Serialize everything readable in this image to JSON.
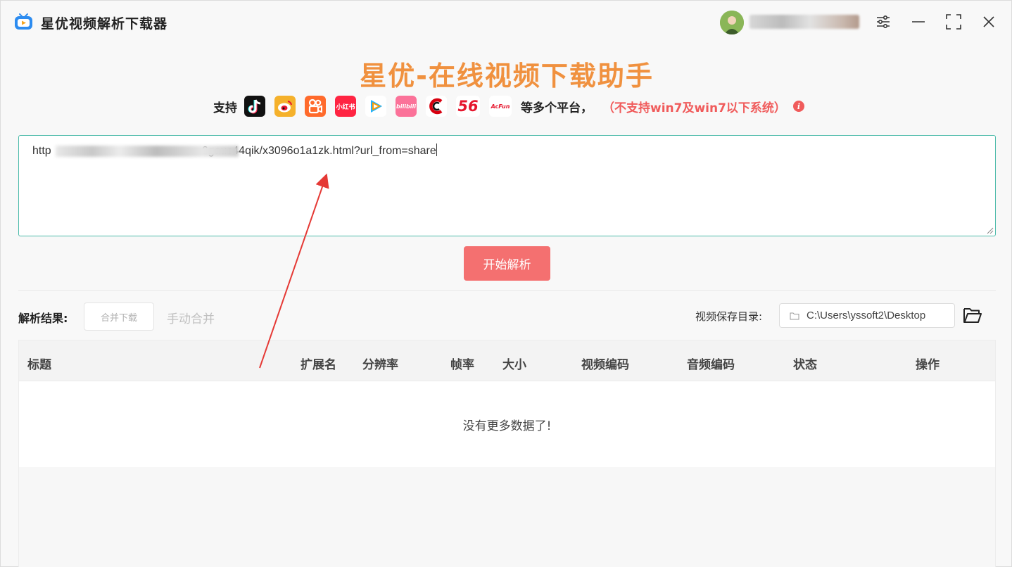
{
  "app": {
    "title": "星优视频解析下载器",
    "brand_color": "#2d8cf0"
  },
  "header": {
    "headline": "星优-在线视频下载助手",
    "support_label": "支持",
    "platforms": [
      {
        "name": "douyin-icon",
        "label": "",
        "color": "#111111"
      },
      {
        "name": "weibo-icon",
        "label": "",
        "color": "#f5b12b"
      },
      {
        "name": "kuaishou-icon",
        "label": "",
        "color": "#ff6a2b"
      },
      {
        "name": "xiaohongshu-icon",
        "label": "小红书",
        "color": "#ff2442"
      },
      {
        "name": "tencent-video-icon",
        "label": "",
        "color": "#ffffff"
      },
      {
        "name": "bilibili-icon",
        "label": "bilibili",
        "color": "#fb7299"
      },
      {
        "name": "cctv-icon",
        "label": "",
        "color": "#ffffff"
      },
      {
        "name": "56-icon",
        "label": "56",
        "color": "#ffffff"
      },
      {
        "name": "acfun-icon",
        "label": "AcFun",
        "color": "#ffffff"
      }
    ],
    "platform_more": "等多个平台，",
    "warning": "（不支持win7及win7以下系统）"
  },
  "url_input": {
    "value_prefix": "http",
    "value_suffix": "6gauc44qik/x3096o1a1zk.html?url_from=share"
  },
  "actions": {
    "parse_label": "开始解析"
  },
  "results": {
    "label": "解析结果:",
    "merge_download_label": "合并下载",
    "manual_merge_label": "手动合并",
    "save_dir_label": "视频保存目录:",
    "save_dir_value": "C:\\Users\\yssoft2\\Desktop"
  },
  "table": {
    "columns": [
      "标题",
      "扩展名",
      "分辨率",
      "帧率",
      "大小",
      "视频编码",
      "音频编码",
      "状态",
      "操作"
    ],
    "empty_text": "没有更多数据了!"
  },
  "colors": {
    "accent_orange": "#f0913f",
    "parse_button": "#f47070",
    "warning_red": "#f05b5b",
    "input_border": "#4dbbaa",
    "annotation_arrow": "#e53935"
  }
}
